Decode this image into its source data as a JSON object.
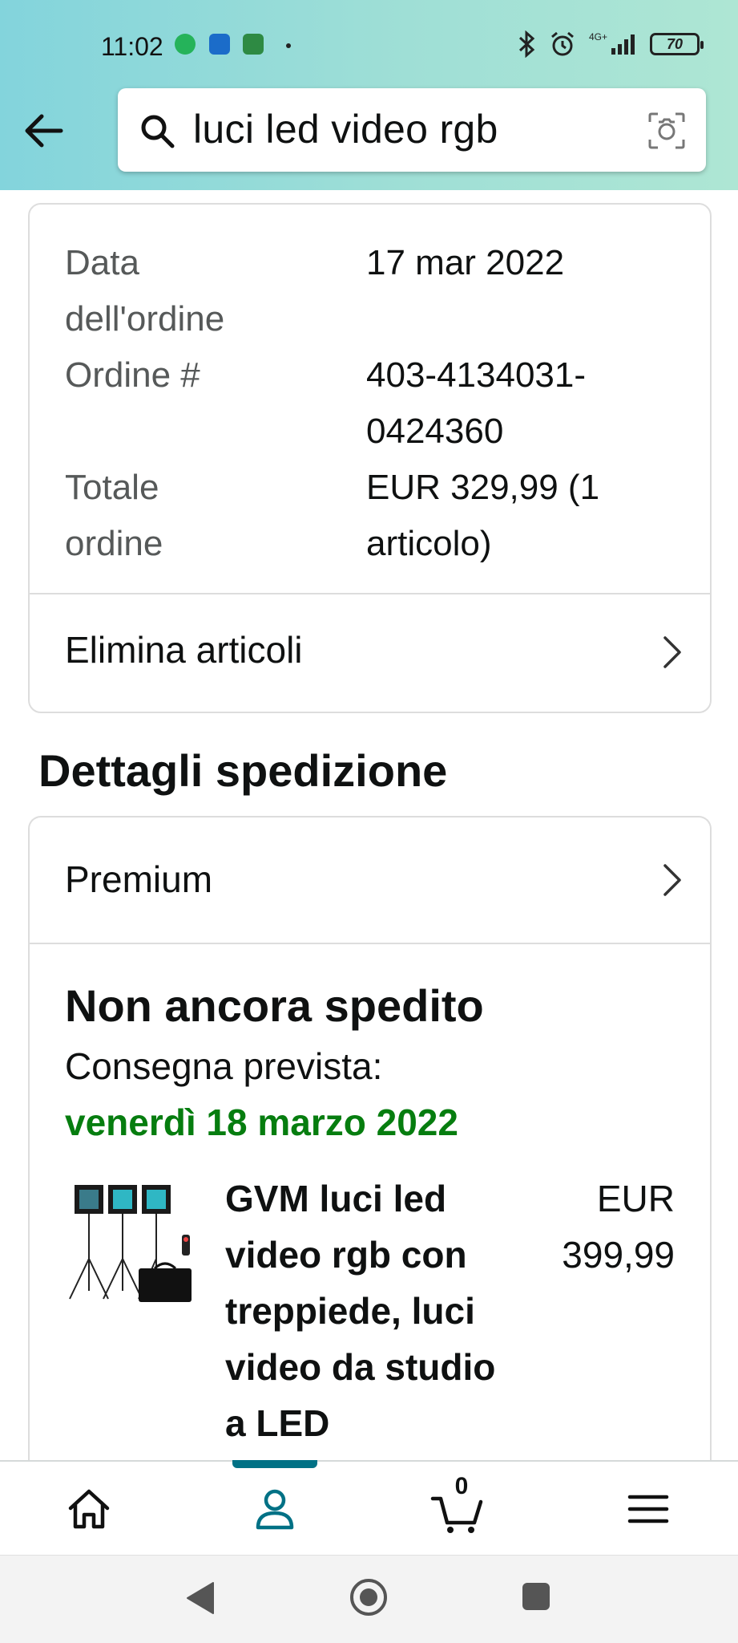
{
  "status_bar": {
    "time": "11:02",
    "battery": "70",
    "network": "4G+"
  },
  "search": {
    "query": "luci led video rgb"
  },
  "order_summary": {
    "rows": [
      {
        "label": "Data dell'ordine",
        "value": "17 mar 2022"
      },
      {
        "label": "Ordine #",
        "value": "403-4134031-0424360"
      },
      {
        "label": "Totale ordine",
        "value": "EUR 329,99 (1 articolo)"
      }
    ],
    "remove_items_label": "Elimina articoli"
  },
  "shipping": {
    "section_title": "Dettagli spedizione",
    "shipping_type": "Premium",
    "status": "Non ancora spedito",
    "delivery_label": "Consegna prevista:",
    "delivery_date": "venerdì 18 marzo 2022",
    "delivery_date_color": "#067d0f",
    "product": {
      "title": "GVM luci led video rgb con treppiede, luci video da studio a LED",
      "price": "EUR 399,99",
      "thumbnail_icon": "led-light-kit-product-image"
    }
  },
  "bottom_nav": {
    "items": [
      "home-icon",
      "account-icon",
      "cart-icon",
      "menu-icon"
    ],
    "cart_count": "0",
    "active_item": "account-icon",
    "accent_color": "#007185"
  },
  "android_nav": [
    "back-triangle-icon",
    "home-circle-icon",
    "recents-square-icon"
  ]
}
